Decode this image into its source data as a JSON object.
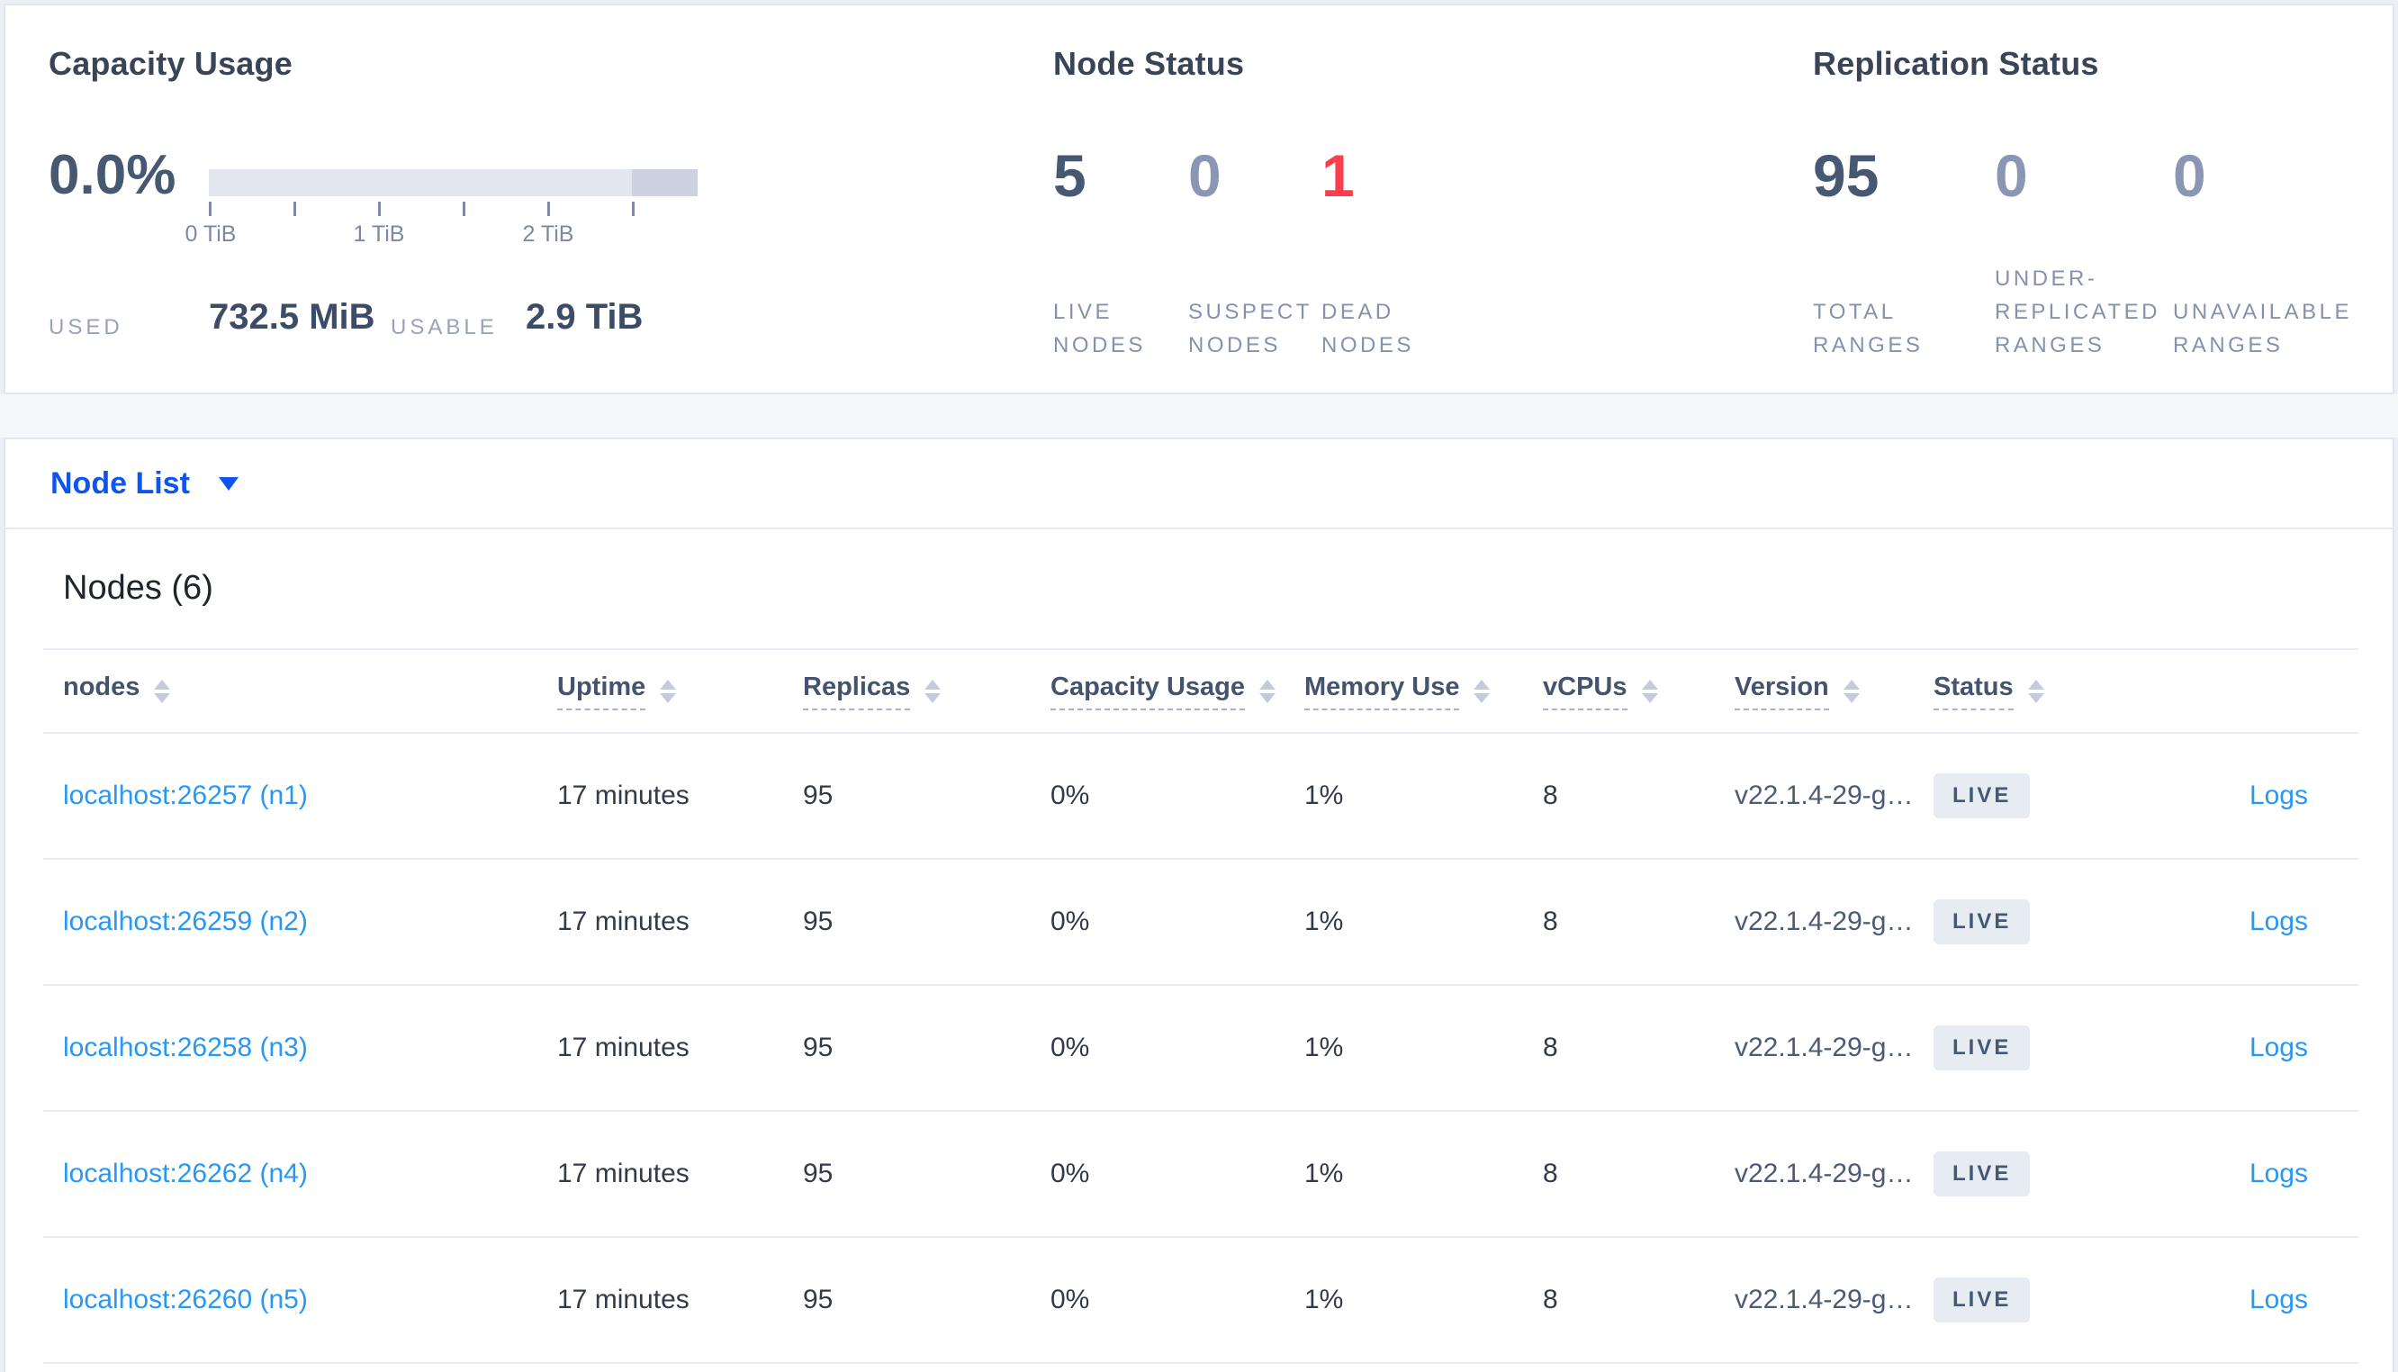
{
  "colors": {
    "link_blue": "#2997f4",
    "node_list_blue": "#0d55ef",
    "dead_red": "#ff3b4e",
    "stat_dark": "#475872",
    "stat_light": "#8b96b5",
    "badge_bg": "#e7ebf2"
  },
  "summary": {
    "capacity": {
      "title": "Capacity Usage",
      "percent": "0.0%",
      "tick_labels": [
        "0 TiB",
        "1 TiB",
        "2 TiB"
      ],
      "used_label": "USED",
      "used_value": "732.5 MiB",
      "usable_label": "USABLE",
      "usable_value": "2.9 TiB"
    },
    "node_status": {
      "title": "Node Status",
      "stats": [
        {
          "value": "5",
          "label": "LIVE\nNODES",
          "tone": "dark"
        },
        {
          "value": "0",
          "label": "SUSPECT\nNODES",
          "tone": "light"
        },
        {
          "value": "1",
          "label": "DEAD\nNODES",
          "tone": "red"
        }
      ]
    },
    "replication": {
      "title": "Replication Status",
      "stats": [
        {
          "value": "95",
          "label": "TOTAL\nRANGES",
          "tone": "dark"
        },
        {
          "value": "0",
          "label": "UNDER-\nREPLICATED\nRANGES",
          "tone": "light"
        },
        {
          "value": "0",
          "label": "UNAVAILABLE\nRANGES",
          "tone": "light"
        }
      ]
    }
  },
  "node_list": {
    "label": "Node List"
  },
  "table": {
    "title": "Nodes (6)",
    "columns": [
      {
        "label": "nodes"
      },
      {
        "label": "Uptime"
      },
      {
        "label": "Replicas"
      },
      {
        "label": "Capacity Usage"
      },
      {
        "label": "Memory Use"
      },
      {
        "label": "vCPUs"
      },
      {
        "label": "Version"
      },
      {
        "label": "Status"
      }
    ],
    "rows": [
      {
        "node": "localhost:26257 (n1)",
        "uptime": "17 minutes",
        "replicas": "95",
        "capacity": "0%",
        "memory": "1%",
        "vcpus": "8",
        "version": "v22.1.4-29-g…",
        "status": "LIVE",
        "logs": "Logs"
      },
      {
        "node": "localhost:26259 (n2)",
        "uptime": "17 minutes",
        "replicas": "95",
        "capacity": "0%",
        "memory": "1%",
        "vcpus": "8",
        "version": "v22.1.4-29-g…",
        "status": "LIVE",
        "logs": "Logs"
      },
      {
        "node": "localhost:26258 (n3)",
        "uptime": "17 minutes",
        "replicas": "95",
        "capacity": "0%",
        "memory": "1%",
        "vcpus": "8",
        "version": "v22.1.4-29-g…",
        "status": "LIVE",
        "logs": "Logs"
      },
      {
        "node": "localhost:26262 (n4)",
        "uptime": "17 minutes",
        "replicas": "95",
        "capacity": "0%",
        "memory": "1%",
        "vcpus": "8",
        "version": "v22.1.4-29-g…",
        "status": "LIVE",
        "logs": "Logs"
      },
      {
        "node": "localhost:26260 (n5)",
        "uptime": "17 minutes",
        "replicas": "95",
        "capacity": "0%",
        "memory": "1%",
        "vcpus": "8",
        "version": "v22.1.4-29-g…",
        "status": "LIVE",
        "logs": "Logs"
      }
    ]
  }
}
